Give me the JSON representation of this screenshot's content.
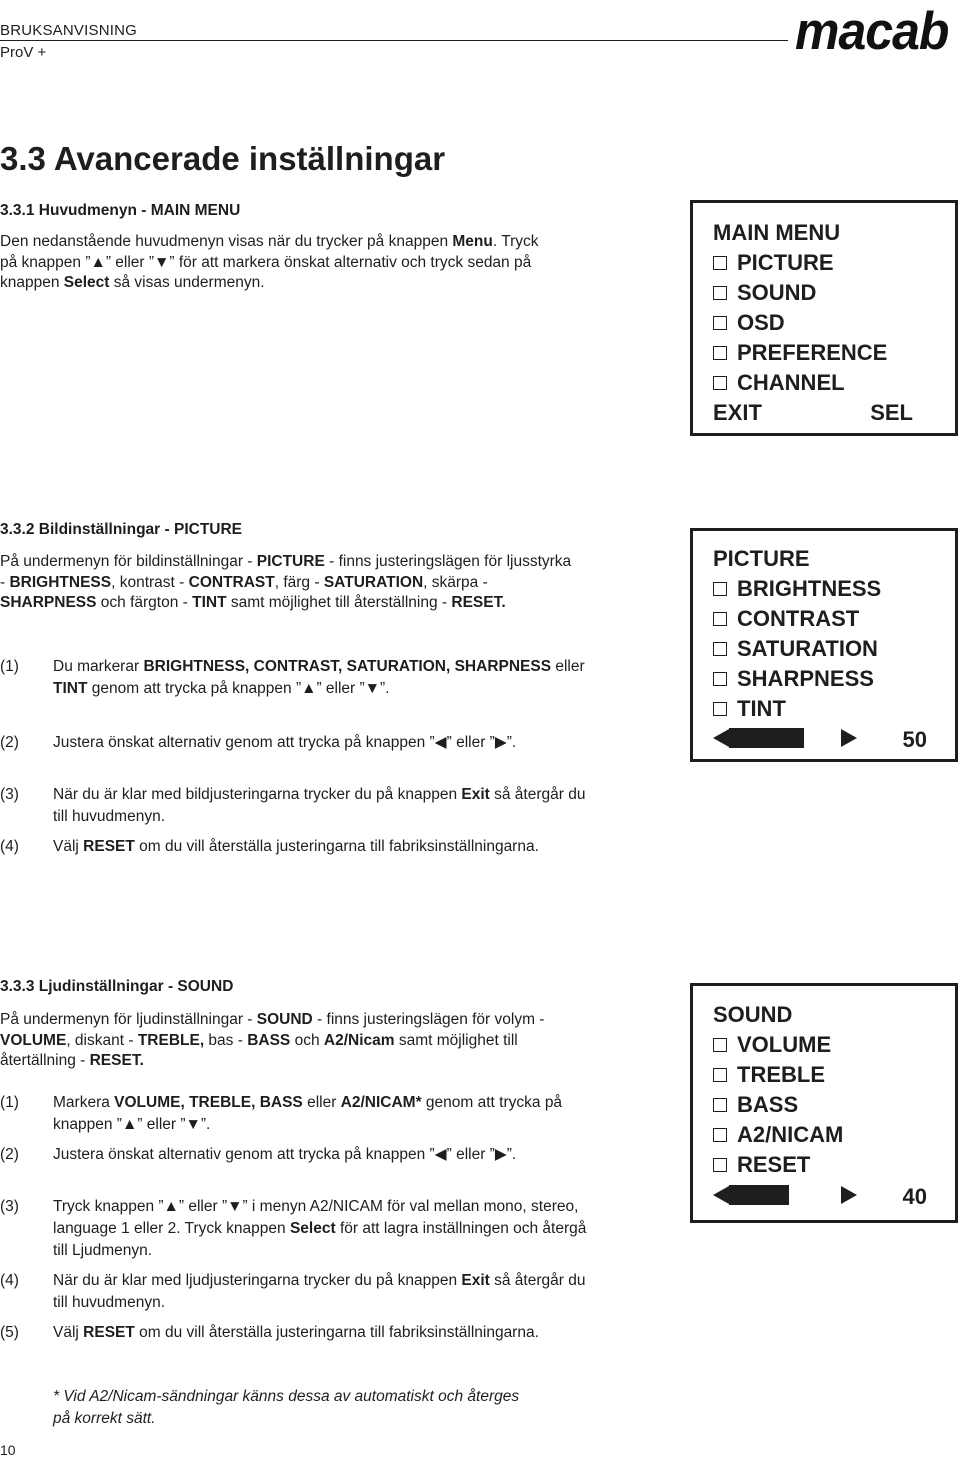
{
  "header": {
    "title": "BRUKSANVISNING",
    "subtitle": "ProV +",
    "logo": "macab"
  },
  "main_heading": "3.3 Avancerade inställningar",
  "section1": {
    "heading": "3.3.1 Huvudmenyn - MAIN MENU",
    "para": [
      {
        "t": "Den nedanstående huvudmenyn visas när du trycker på knappen "
      },
      {
        "b": "Menu"
      },
      {
        "t": ". Tryck på knappen ”▲” eller ”▼” för att markera önskat alternativ och tryck sedan på knappen "
      },
      {
        "b": "Select"
      },
      {
        "t": " så visas undermenyn."
      }
    ],
    "osd": {
      "title": "MAIN  MENU",
      "items": [
        "PICTURE",
        "SOUND",
        "OSD",
        "PREFERENCE",
        "CHANNEL"
      ],
      "footer_left": "EXIT",
      "footer_right": "SEL"
    }
  },
  "section2": {
    "heading": "3.3.2  Bildinställningar - PICTURE",
    "para": [
      {
        "t": "På undermenyn för bildinställningar - "
      },
      {
        "b": "PICTURE"
      },
      {
        "t": " - finns justeringslägen för ljusstyrka - "
      },
      {
        "b": "BRIGHTNESS"
      },
      {
        "t": ", kontrast - "
      },
      {
        "b": "CONTRAST"
      },
      {
        "t": ", färg - "
      },
      {
        "b": "SATURATION"
      },
      {
        "t": ", skärpa - "
      },
      {
        "b": "SHARPNESS"
      },
      {
        "t": " och färgton - "
      },
      {
        "b": "TINT"
      },
      {
        "t": " samt möjlighet till återställning - "
      },
      {
        "b": "RESET."
      }
    ],
    "steps": [
      {
        "num": "(1)",
        "parts": [
          {
            "t": "Du markerar "
          },
          {
            "b": "BRIGHTNESS, CONTRAST, SATURATION, SHARPNESS"
          },
          {
            "t": " eller "
          },
          {
            "b": "TINT"
          },
          {
            "t": " genom att trycka på knappen ”▲” eller ”▼”."
          }
        ]
      },
      {
        "num": "(2)",
        "parts": [
          {
            "t": "Justera önskat alternativ genom att trycka på knappen ”◀” eller ”▶”."
          }
        ]
      },
      {
        "num": "(3)",
        "parts": [
          {
            "t": "När du är klar med bildjusteringarna trycker du på knappen "
          },
          {
            "b": "Exit"
          },
          {
            "t": " så återgår du till huvudmenyn."
          }
        ]
      },
      {
        "num": "(4)",
        "parts": [
          {
            "t": "Välj "
          },
          {
            "b": "RESET"
          },
          {
            "t": " om du vill återställa justeringarna till fabriksinställningarna."
          }
        ]
      }
    ],
    "osd": {
      "title": "PICTURE",
      "items": [
        "BRIGHTNESS",
        "CONTRAST",
        "SATURATION",
        "SHARPNESS",
        "TINT"
      ],
      "slider_value": 50,
      "slider_value_label": "50"
    }
  },
  "section3": {
    "heading": "3.3.3  Ljudinställningar - SOUND",
    "para": [
      {
        "t": "På undermenyn för ljudinställningar - "
      },
      {
        "b": "SOUND"
      },
      {
        "t": " - finns justeringslägen för volym - "
      },
      {
        "b": "VOLUME"
      },
      {
        "t": ", diskant - "
      },
      {
        "b": "TREBLE,"
      },
      {
        "t": " bas - "
      },
      {
        "b": "BASS"
      },
      {
        "t": " och "
      },
      {
        "b": "A2/Nicam"
      },
      {
        "t": " samt möjlighet till återtällning - "
      },
      {
        "b": "RESET."
      }
    ],
    "steps": [
      {
        "num": "(1)",
        "parts": [
          {
            "t": "Markera "
          },
          {
            "b": "VOLUME, TREBLE, BASS"
          },
          {
            "t": " eller "
          },
          {
            "b": "A2/NICAM*"
          },
          {
            "t": " genom att trycka på knappen ”▲” eller ”▼”."
          }
        ]
      },
      {
        "num": "(2)",
        "parts": [
          {
            "t": "Justera önskat alternativ genom att trycka på knappen ”◀” eller ”▶”."
          }
        ]
      },
      {
        "num": "(3)",
        "parts": [
          {
            "t": "Tryck knappen ”▲” eller ”▼” i menyn A2/NICAM för val mellan mono, stereo, language 1 eller 2. Tryck knappen "
          },
          {
            "b": "Select"
          },
          {
            "t": " för att lagra inställningen och återgå till Ljudmenyn."
          }
        ]
      },
      {
        "num": "(4)",
        "parts": [
          {
            "t": "När du är klar med ljudjusteringarna trycker du på knappen "
          },
          {
            "b": "Exit"
          },
          {
            "t": " så återgår du till huvudmenyn."
          }
        ]
      },
      {
        "num": "(5)",
        "parts": [
          {
            "t": "Välj "
          },
          {
            "b": "RESET"
          },
          {
            "t": " om du vill återställa justeringarna till fabriksinställningarna."
          }
        ]
      }
    ],
    "osd": {
      "title": "SOUND",
      "items": [
        "VOLUME",
        "TREBLE",
        "BASS",
        "A2/NICAM",
        "RESET"
      ],
      "slider_value": 40,
      "slider_value_label": "40"
    },
    "footnote": "* Vid A2/Nicam-sändningar känns dessa av automatiskt och återges på korrekt sätt."
  },
  "page_number": "10"
}
